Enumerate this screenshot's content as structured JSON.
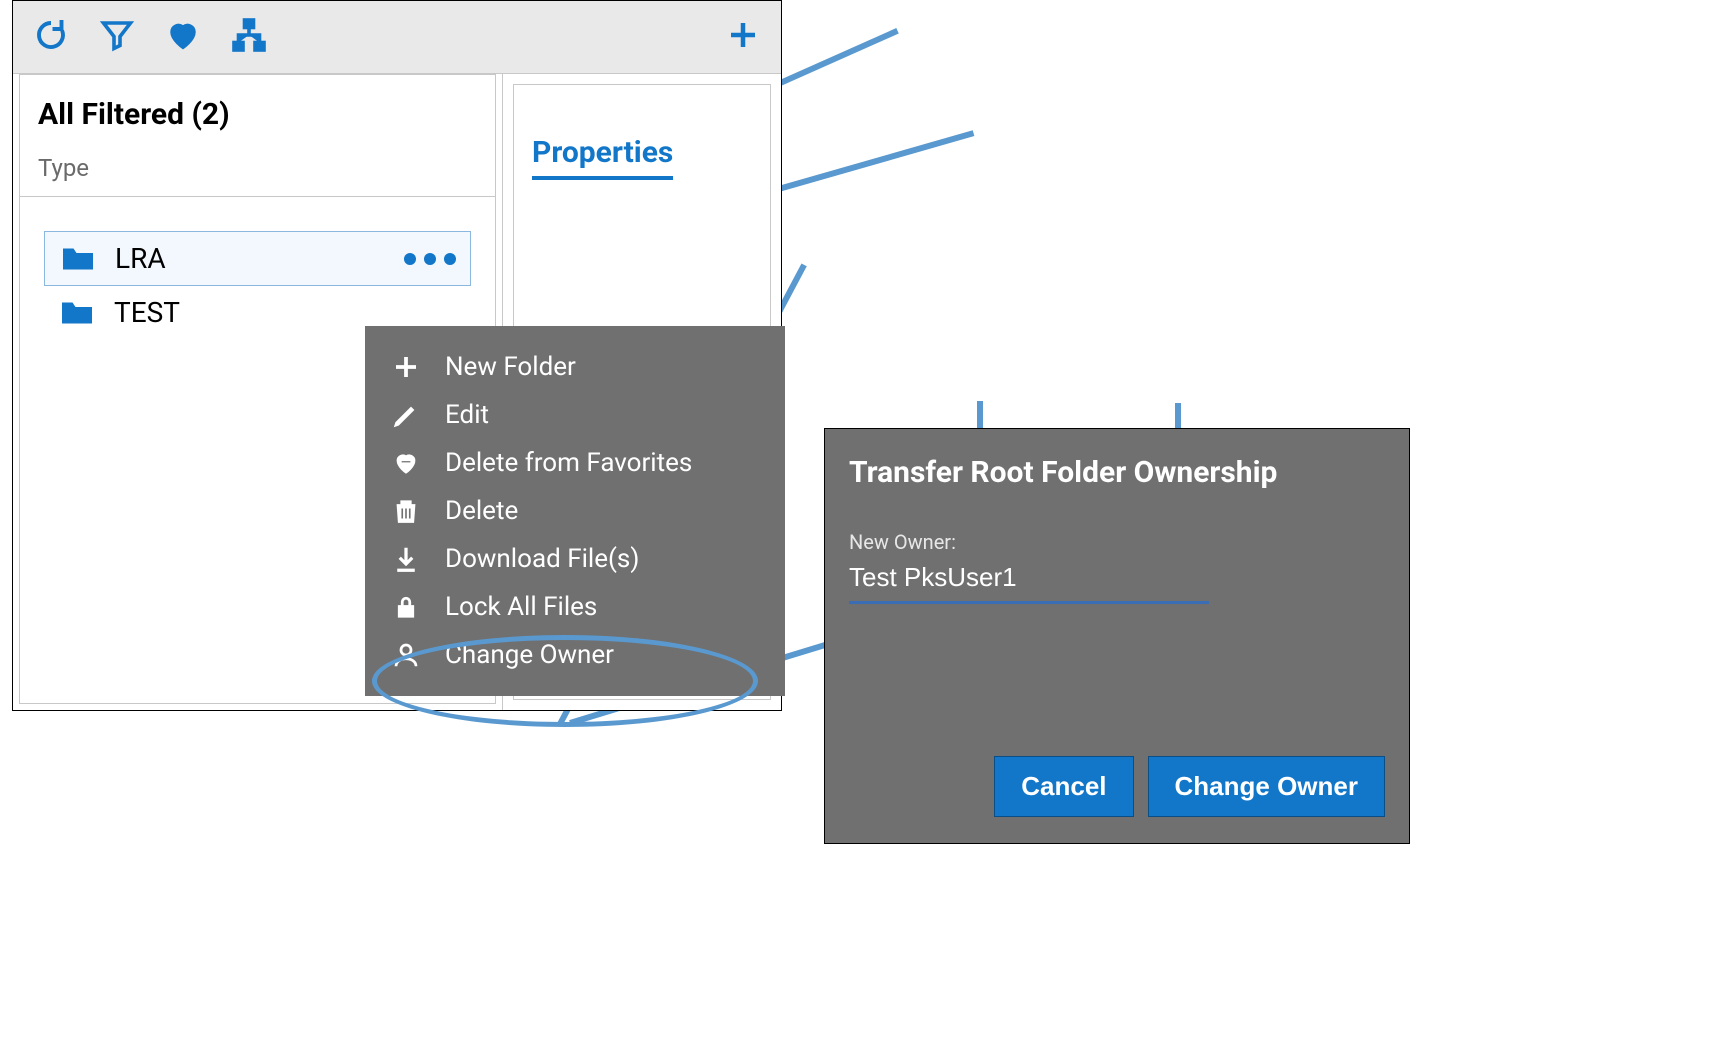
{
  "toolbar": {
    "icons": [
      "refresh-icon",
      "filter-icon",
      "heart-icon",
      "tree-icon",
      "plus-icon"
    ]
  },
  "panel": {
    "header": "All Filtered (2)",
    "type_label": "Type",
    "folders": [
      {
        "name": "LRA",
        "selected": true
      },
      {
        "name": "TEST",
        "selected": false
      }
    ]
  },
  "properties": {
    "tab_label": "Properties"
  },
  "context_menu": {
    "items": [
      {
        "icon": "plus-icon",
        "label": "New Folder"
      },
      {
        "icon": "pencil-icon",
        "label": "Edit"
      },
      {
        "icon": "heart-minus-icon",
        "label": "Delete from Favorites"
      },
      {
        "icon": "trash-icon",
        "label": "Delete"
      },
      {
        "icon": "download-icon",
        "label": "Download File(s)"
      },
      {
        "icon": "lock-icon",
        "label": "Lock All Files"
      },
      {
        "icon": "person-icon",
        "label": "Change Owner"
      }
    ]
  },
  "dialog": {
    "title": "Transfer Root Folder Ownership",
    "field_label": "New Owner:",
    "field_value": "Test PksUser1",
    "cancel_label": "Cancel",
    "confirm_label": "Change Owner"
  }
}
